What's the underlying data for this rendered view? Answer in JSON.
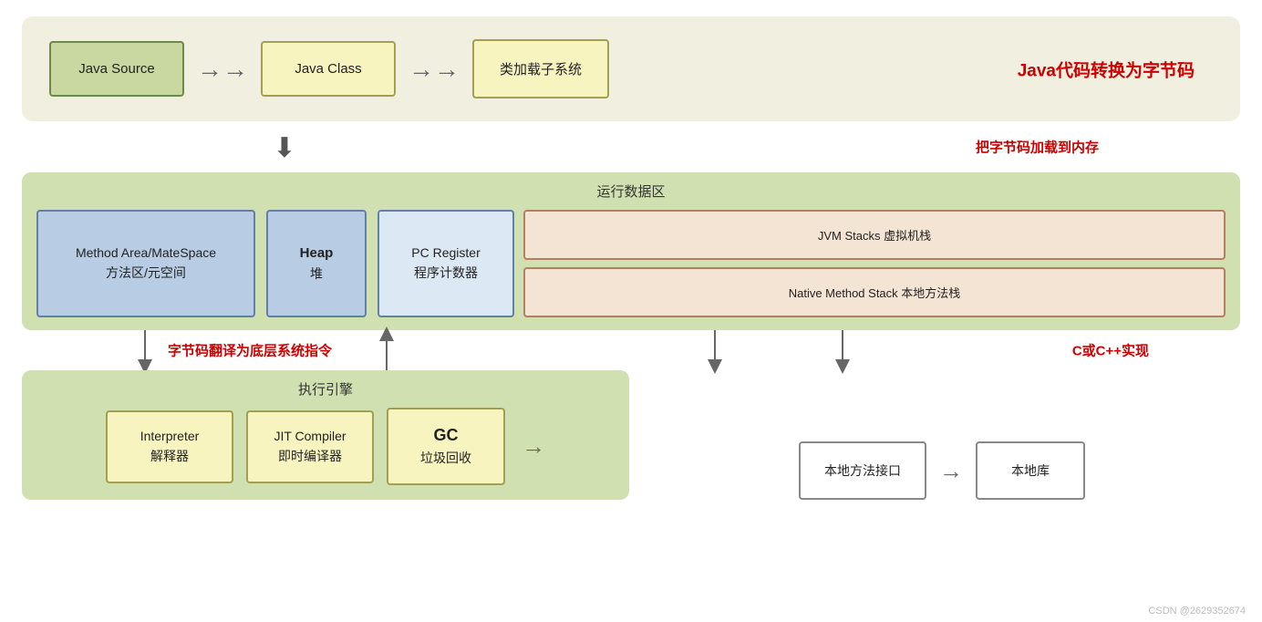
{
  "top": {
    "bg": "#f0efe6",
    "boxes": [
      {
        "id": "java-source",
        "line1": "Java Source",
        "line2": ""
      },
      {
        "id": "java-class",
        "line1": "Java Class",
        "line2": ""
      },
      {
        "id": "class-loader",
        "line1": "类加载子系统",
        "line2": ""
      }
    ],
    "label": "Java代码转换为字节码"
  },
  "mid_arrow_label": "把字节码加载到内存",
  "middle": {
    "title": "运行数据区",
    "method_area": {
      "line1": "Method Area/MateSpace",
      "line2": "方法区/元空间"
    },
    "heap": {
      "line1": "Heap",
      "line2": "堆"
    },
    "pc_register": {
      "line1": "PC Register",
      "line2": "程序计数器"
    },
    "jvm_stacks": {
      "line1": "JVM Stacks 虚拟机栈"
    },
    "native_method_stack": {
      "line1": "Native Method Stack 本地方法栈"
    }
  },
  "bytecode_label": "字节码翻译为底层系统指令",
  "bottom_left": {
    "title": "执行引擎",
    "boxes": [
      {
        "id": "interpreter",
        "line1": "Interpreter",
        "line2": "解释器"
      },
      {
        "id": "jit",
        "line1": "JIT Compiler",
        "line2": "即时编译器"
      },
      {
        "id": "gc",
        "line1": "GC",
        "line2": "垃圾回收"
      }
    ]
  },
  "bottom_right": {
    "label": "C或C++实现",
    "native_interface": {
      "text": "本地方法接口"
    },
    "native_library": {
      "text": "本地库"
    }
  },
  "watermark": "CSDN @2629352674"
}
